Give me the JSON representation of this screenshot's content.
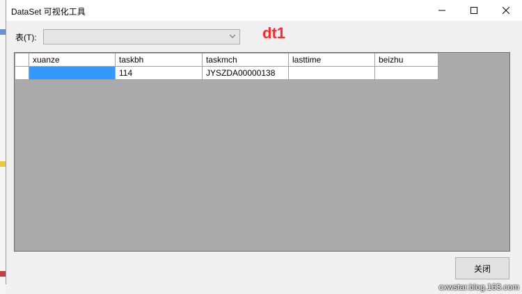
{
  "window": {
    "title": "DataSet 可视化工具"
  },
  "form": {
    "table_label": "表(T):",
    "table_combo_value": "",
    "dataset_name": "dt1"
  },
  "grid": {
    "columns": [
      "xuanze",
      "taskbh",
      "taskmch",
      "lasttime",
      "beizhu"
    ],
    "rows": [
      [
        "",
        "114",
        "JYSZDA00000138",
        "",
        ""
      ]
    ]
  },
  "buttons": {
    "close_label": "关闭"
  },
  "watermark": "cxwstar.blog.163.com",
  "colors": {
    "selection": "#3399ff",
    "dataset_label": "#ff2a2a",
    "grid_background": "#aaaaaa"
  }
}
